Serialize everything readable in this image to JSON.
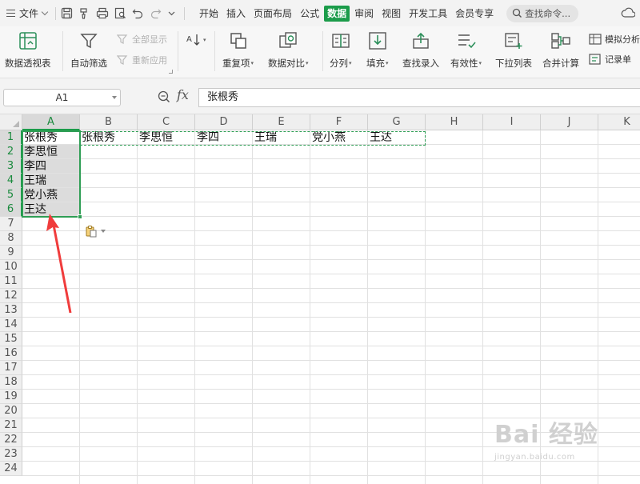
{
  "menu": {
    "file_label": "文件",
    "tabs": [
      {
        "label": "开始",
        "active": false
      },
      {
        "label": "插入",
        "active": false
      },
      {
        "label": "页面布局",
        "active": false
      },
      {
        "label": "公式",
        "active": false
      },
      {
        "label": "数据",
        "active": true
      },
      {
        "label": "审阅",
        "active": false
      },
      {
        "label": "视图",
        "active": false
      },
      {
        "label": "开发工具",
        "active": false
      },
      {
        "label": "会员专享",
        "active": false
      }
    ],
    "search_placeholder": "查找命令..."
  },
  "ribbon": {
    "pivot_table": "数据透视表",
    "auto_filter": "自动筛选",
    "show_all": "全部显示",
    "reapply": "重新应用",
    "duplicates": "重复项",
    "compare": "数据对比",
    "split_column": "分列",
    "fill": "填充",
    "lookup_entry": "查找录入",
    "validity": "有效性",
    "dropdown_list": "下拉列表",
    "consolidate": "合并计算",
    "simulate": "模拟分析",
    "record_sheet": "记录单"
  },
  "formula_bar": {
    "name_box": "A1",
    "fx": "fx",
    "content": "张根秀"
  },
  "columns": [
    "A",
    "B",
    "C",
    "D",
    "E",
    "F",
    "G",
    "H",
    "I",
    "J",
    "K"
  ],
  "rows": [
    "1",
    "2",
    "3",
    "4",
    "5",
    "6",
    "7",
    "8",
    "9",
    "10",
    "11",
    "12",
    "13",
    "14",
    "15",
    "16",
    "17",
    "18",
    "19",
    "20",
    "21",
    "22",
    "23",
    "24"
  ],
  "cells": {
    "A1": "张根秀",
    "A2": "李思恒",
    "A3": "李四",
    "A4": "王瑞",
    "A5": "党小燕",
    "A6": "王达",
    "B1": "张根秀",
    "C1": "李思恒",
    "D1": "李四",
    "E1": "王瑞",
    "F1": "党小燕",
    "G1": "王达"
  },
  "colors": {
    "accent": "#1b9c4a",
    "selection_border": "#2f9e55",
    "annotation_arrow": "#f03c3c"
  },
  "watermark": {
    "logo": "Bai 经验",
    "url": "jingyan.baidu.com"
  }
}
